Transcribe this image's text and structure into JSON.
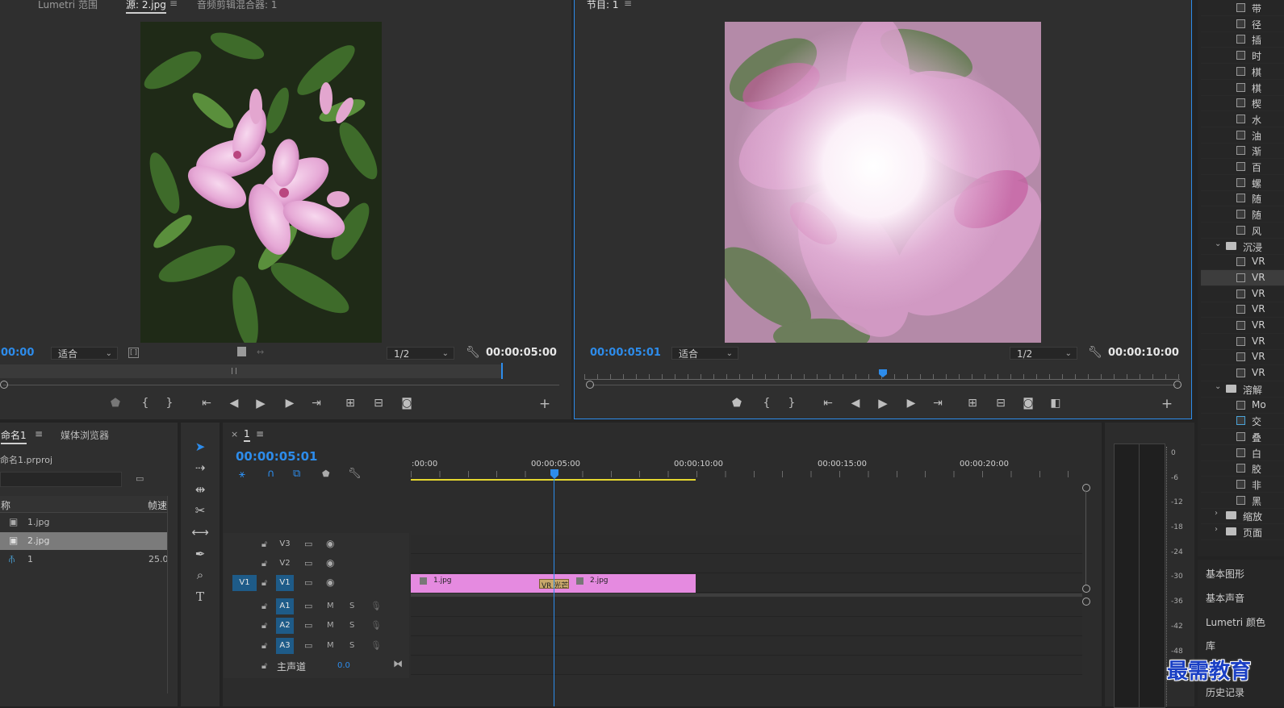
{
  "source_monitor": {
    "tabs": [
      "Lumetri 范围",
      "源: 2.jpg",
      "音频剪辑混合器: 1"
    ],
    "menu_icon": "≡",
    "timecode_left": "00:00",
    "fit": "适合",
    "resolution": "1/2",
    "timecode_right": "00:00:05:00"
  },
  "program_monitor": {
    "tab": "节目: 1",
    "menu_icon": "≡",
    "timecode_left": "00:00:05:01",
    "fit": "适合",
    "resolution": "1/2",
    "timecode_right": "00:00:10:00"
  },
  "project_panel": {
    "tabs": [
      "命名1",
      "媒体浏览器"
    ],
    "menu_icon": "≡",
    "project_file": "命名1.prproj",
    "col_name": "称",
    "col_rate": "帧速",
    "items": [
      {
        "name": "1.jpg",
        "rate": ""
      },
      {
        "name": "2.jpg",
        "rate": ""
      },
      {
        "name": "1",
        "rate": "25.0"
      }
    ]
  },
  "timeline": {
    "tab_close": "×",
    "tab_name": "1",
    "menu_icon": "≡",
    "timecode": "00:00:05:01",
    "ruler_labels": [
      ":00:00",
      "00:00:05:00",
      "00:00:10:00",
      "00:00:15:00",
      "00:00:20:00"
    ],
    "video_tracks": [
      {
        "name": "V3",
        "source": ""
      },
      {
        "name": "V2",
        "source": ""
      },
      {
        "name": "V1",
        "source": "V1"
      }
    ],
    "audio_tracks": [
      "A1",
      "A2",
      "A3"
    ],
    "track_m": "M",
    "track_s": "S",
    "master_label": "主声道",
    "master_value": "0.0",
    "clips": [
      {
        "name": "1.jpg"
      },
      {
        "name": "2.jpg"
      }
    ],
    "transition_label": "VR 光芒"
  },
  "meter": {
    "labels": [
      "0",
      "-6",
      "-12",
      "-18",
      "-24",
      "-30",
      "-36",
      "-42",
      "-48"
    ]
  },
  "effects_panel": {
    "rows": [
      {
        "type": "fx",
        "label": "带"
      },
      {
        "type": "fx",
        "label": "径"
      },
      {
        "type": "fx",
        "label": "插"
      },
      {
        "type": "fx",
        "label": "时"
      },
      {
        "type": "fx",
        "label": "棋"
      },
      {
        "type": "fx",
        "label": "棋"
      },
      {
        "type": "fx",
        "label": "楔"
      },
      {
        "type": "fx",
        "label": "水"
      },
      {
        "type": "fx",
        "label": "油"
      },
      {
        "type": "fx",
        "label": "渐"
      },
      {
        "type": "fx",
        "label": "百"
      },
      {
        "type": "fx",
        "label": "螺"
      },
      {
        "type": "fx",
        "label": "随"
      },
      {
        "type": "fx",
        "label": "随"
      },
      {
        "type": "fx",
        "label": "风"
      },
      {
        "type": "folder",
        "label": "沉浸",
        "open": true
      },
      {
        "type": "fx",
        "label": "VR"
      },
      {
        "type": "fx",
        "label": "VR",
        "selected": true
      },
      {
        "type": "fx",
        "label": "VR"
      },
      {
        "type": "fx",
        "label": "VR"
      },
      {
        "type": "fx",
        "label": "VR"
      },
      {
        "type": "fx",
        "label": "VR"
      },
      {
        "type": "fx",
        "label": "VR"
      },
      {
        "type": "fx",
        "label": "VR"
      },
      {
        "type": "folder",
        "label": "溶解",
        "open": true
      },
      {
        "type": "fx",
        "label": "Mo"
      },
      {
        "type": "fx",
        "label": "交"
      },
      {
        "type": "fx",
        "label": "叠"
      },
      {
        "type": "fx",
        "label": "白"
      },
      {
        "type": "fx",
        "label": "胶"
      },
      {
        "type": "fx",
        "label": "非"
      },
      {
        "type": "fx",
        "label": "黑"
      },
      {
        "type": "folder",
        "label": "缩放",
        "open": false
      },
      {
        "type": "folder",
        "label": "页面",
        "open": false
      }
    ],
    "side_panels": [
      "基本图形",
      "基本声音",
      "Lumetri 颜色",
      "库",
      "历史记录"
    ]
  },
  "watermark": "最需教育",
  "colors": {
    "accent": "#2d8ceb",
    "clip": "#e58ae0",
    "work_area": "#e5d730",
    "track_active": "#1e5b88"
  }
}
